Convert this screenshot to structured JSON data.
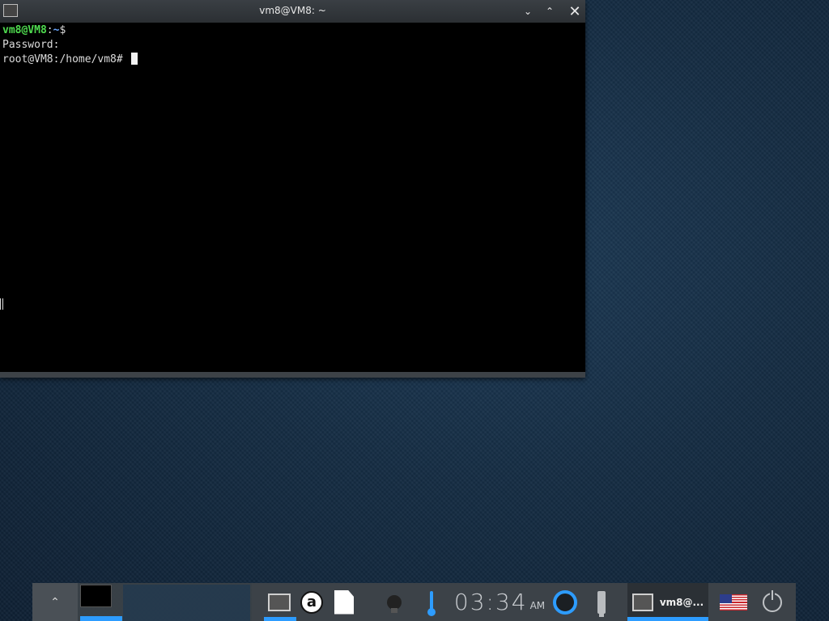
{
  "window": {
    "title": "vm8@VM8: ~",
    "minimize_icon": "chevron-down-icon",
    "maximize_icon": "chevron-up-icon",
    "close_icon": "close-icon"
  },
  "terminal": {
    "prompt_user": "vm8@VM8",
    "prompt_sep": ":",
    "prompt_path": "~",
    "prompt_symbol": "$",
    "password_line": "Password:",
    "root_prompt": "root@VM8:/home/vm8# "
  },
  "taskbar": {
    "up_label": "⌃",
    "launcher_a": "a",
    "clock_time": "03:34",
    "clock_ampm": "AM",
    "task_label": "vm8@...",
    "accent_color": "#2d9cff"
  }
}
